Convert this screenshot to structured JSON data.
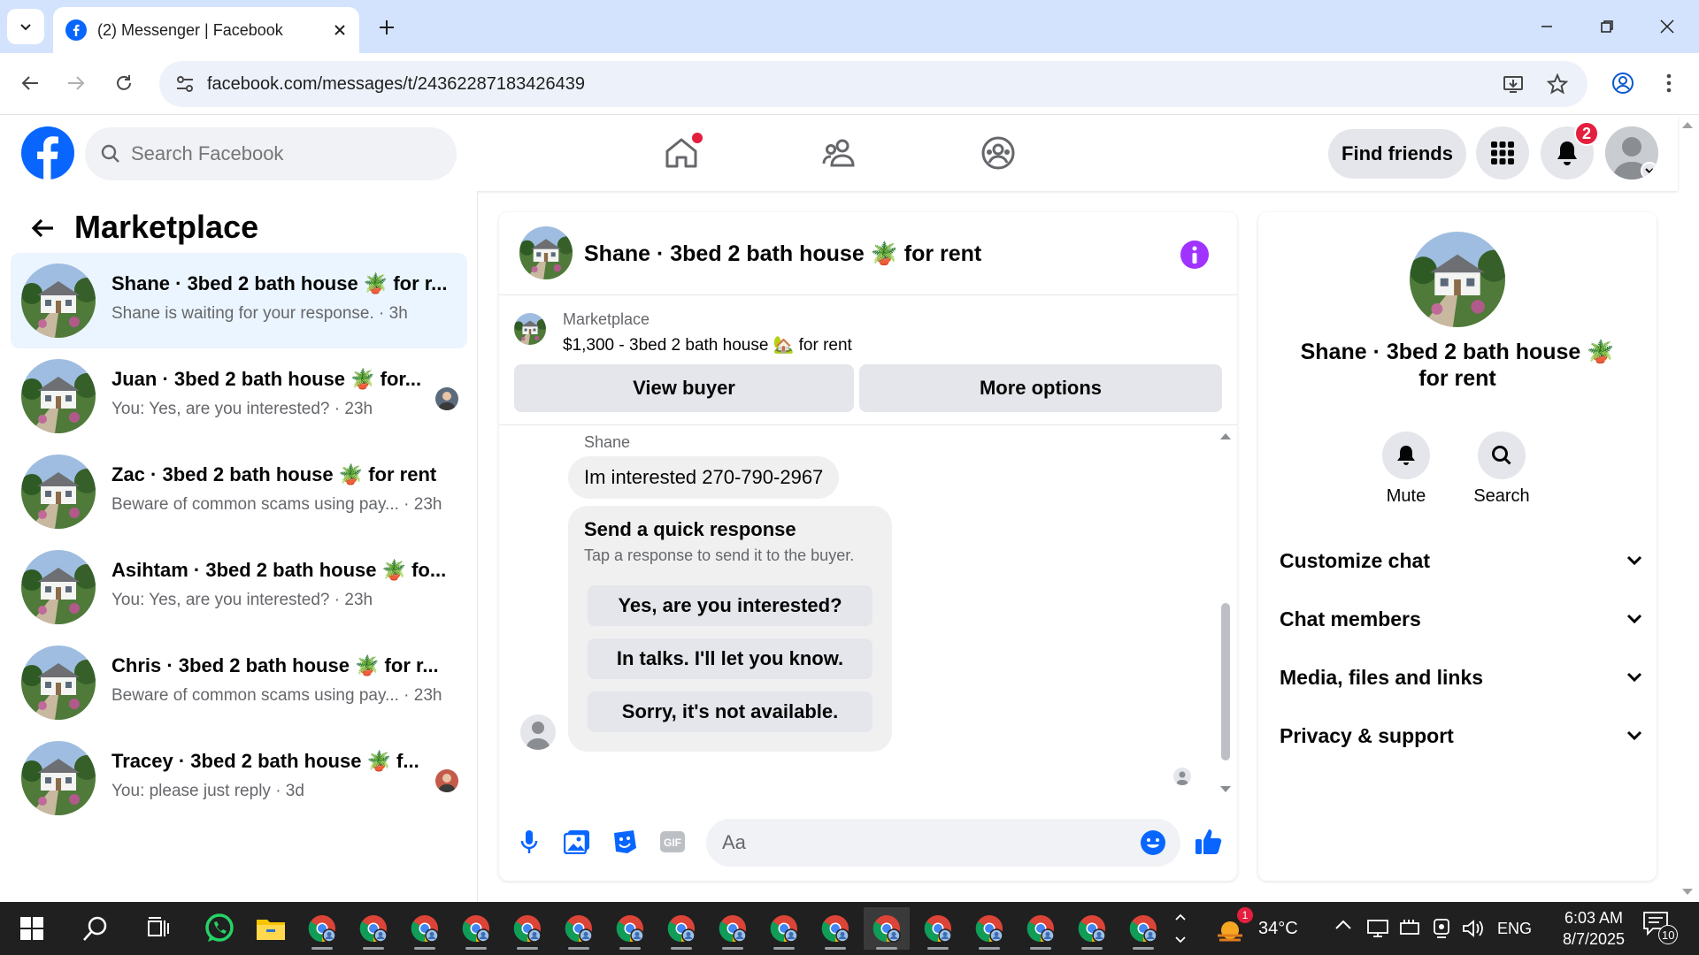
{
  "browser": {
    "tab_title": "(2) Messenger | Facebook",
    "url": "facebook.com/messages/t/24362287183426439"
  },
  "header": {
    "search_placeholder": "Search Facebook",
    "find_friends": "Find friends",
    "notifications_count": "2"
  },
  "sidebar": {
    "title": "Marketplace",
    "conversations": [
      {
        "name": "Shane · 3bed 2 bath house 🪴 for r...",
        "snippet": "Shane is waiting for your response. · 3h",
        "active": true
      },
      {
        "name": "Juan · 3bed 2 bath house 🪴 for...",
        "snippet": "You: Yes, are you interested? · 23h",
        "active": false
      },
      {
        "name": "Zac · 3bed 2 bath house 🪴 for rent",
        "snippet": "Beware of common scams using pay... · 23h",
        "active": false
      },
      {
        "name": "Asihtam · 3bed 2 bath house 🪴 fo...",
        "snippet": "You: Yes, are you interested? · 23h",
        "active": false
      },
      {
        "name": "Chris · 3bed 2 bath house 🪴 for r...",
        "snippet": "Beware of common scams using pay... · 23h",
        "active": false
      },
      {
        "name": "Tracey · 3bed 2 bath house 🪴 f...",
        "snippet": "You: please just reply · 3d",
        "active": false
      }
    ]
  },
  "chat": {
    "title": "Shane · 3bed 2 bath house 🪴 for rent",
    "listing_label": "Marketplace",
    "listing_title": "$1,300 - 3bed 2 bath house 🏡 for rent",
    "view_buyer": "View buyer",
    "more_options": "More options",
    "sender": "Shane",
    "message": "Im interested 270-790-2967",
    "quick_title": "Send a quick response",
    "quick_subtitle": "Tap a response to send it to the buyer.",
    "quick_responses": [
      "Yes, are you interested?",
      "In talks. I'll let you know.",
      "Sorry, it's not available."
    ],
    "composer_placeholder": "Aa"
  },
  "info": {
    "name_line1": "Shane · 3bed 2 bath house 🪴",
    "name_line2": "for rent",
    "mute": "Mute",
    "search": "Search",
    "sections": [
      "Customize chat",
      "Chat members",
      "Media, files and links",
      "Privacy & support"
    ]
  },
  "taskbar": {
    "weather_temp": "34°C",
    "weather_badge": "1",
    "language": "ENG",
    "time": "6:03 AM",
    "date": "8/7/2025",
    "notifications": "10"
  },
  "colors": {
    "fb_blue": "#0866ff",
    "active_row": "#ebf5ff",
    "purple_info": "#a033ff",
    "badge_red": "#e41e3f"
  }
}
